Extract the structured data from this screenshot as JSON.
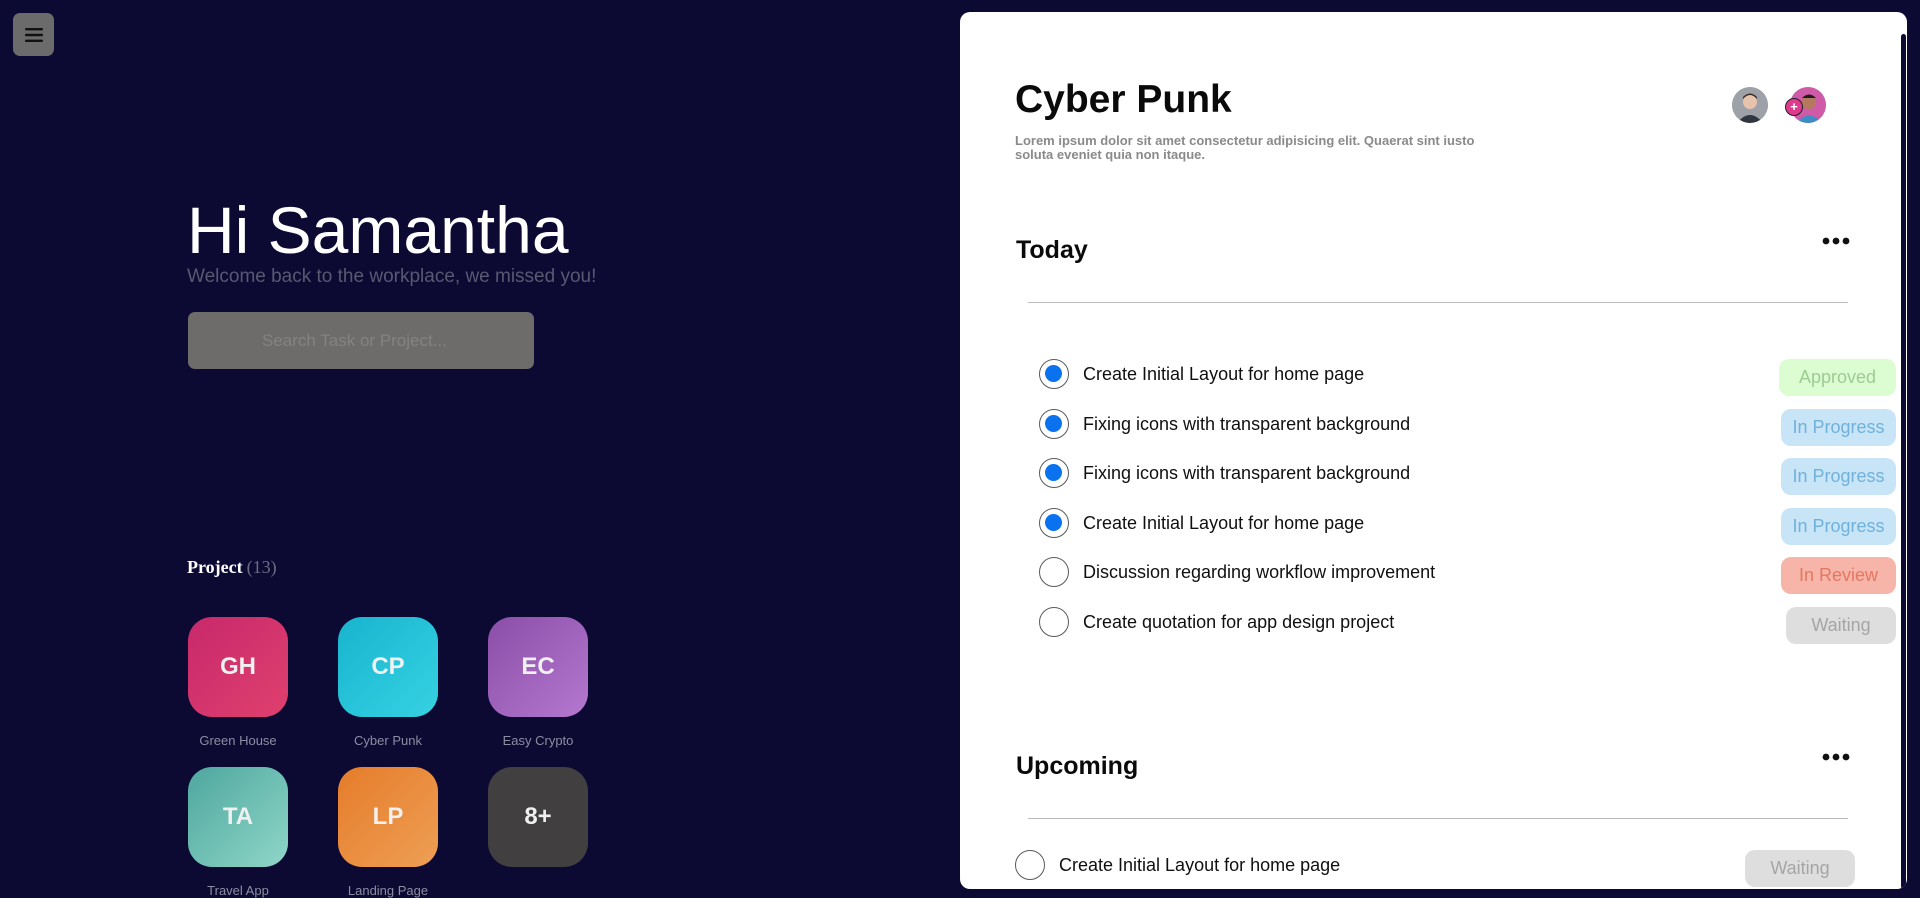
{
  "greeting": "Hi Samantha",
  "welcome": "Welcome back to the workplace, we missed you!",
  "search": {
    "placeholder": "Search Task or Project..."
  },
  "projects": {
    "heading": "Project",
    "count": "(13)",
    "items": [
      {
        "abbr": "GH",
        "name": "Green House"
      },
      {
        "abbr": "CP",
        "name": "Cyber Punk"
      },
      {
        "abbr": "EC",
        "name": "Easy Crypto"
      },
      {
        "abbr": "TA",
        "name": "Travel App"
      },
      {
        "abbr": "LP",
        "name": "Landing Page"
      },
      {
        "abbr": "8+",
        "name": ""
      }
    ]
  },
  "panel": {
    "title": "Cyber Punk",
    "description": "Lorem ipsum dolor sit amet consectetur adipisicing elit. Quaerat sint iusto soluta eveniet quia non itaque.",
    "today": {
      "title": "Today",
      "tasks": [
        {
          "label": "Create Initial Layout for home page",
          "status": "Approved",
          "done": true
        },
        {
          "label": "Fixing icons with transparent background",
          "status": "In Progress",
          "done": true
        },
        {
          "label": "Fixing icons with transparent background",
          "status": "In Progress",
          "done": true
        },
        {
          "label": "Create Initial Layout for home page",
          "status": "In Progress",
          "done": true
        },
        {
          "label": "Discussion regarding workflow improvement",
          "status": "In Review",
          "done": false
        },
        {
          "label": "Create quotation for app design project",
          "status": "Waiting",
          "done": false
        }
      ]
    },
    "upcoming": {
      "title": "Upcoming",
      "tasks": [
        {
          "label": "Create Initial Layout for home page",
          "status": "Waiting",
          "done": false
        }
      ]
    }
  },
  "colors": {
    "background": "#0c0a33",
    "panel": "#ffffff",
    "checked": "#0a72ef"
  }
}
